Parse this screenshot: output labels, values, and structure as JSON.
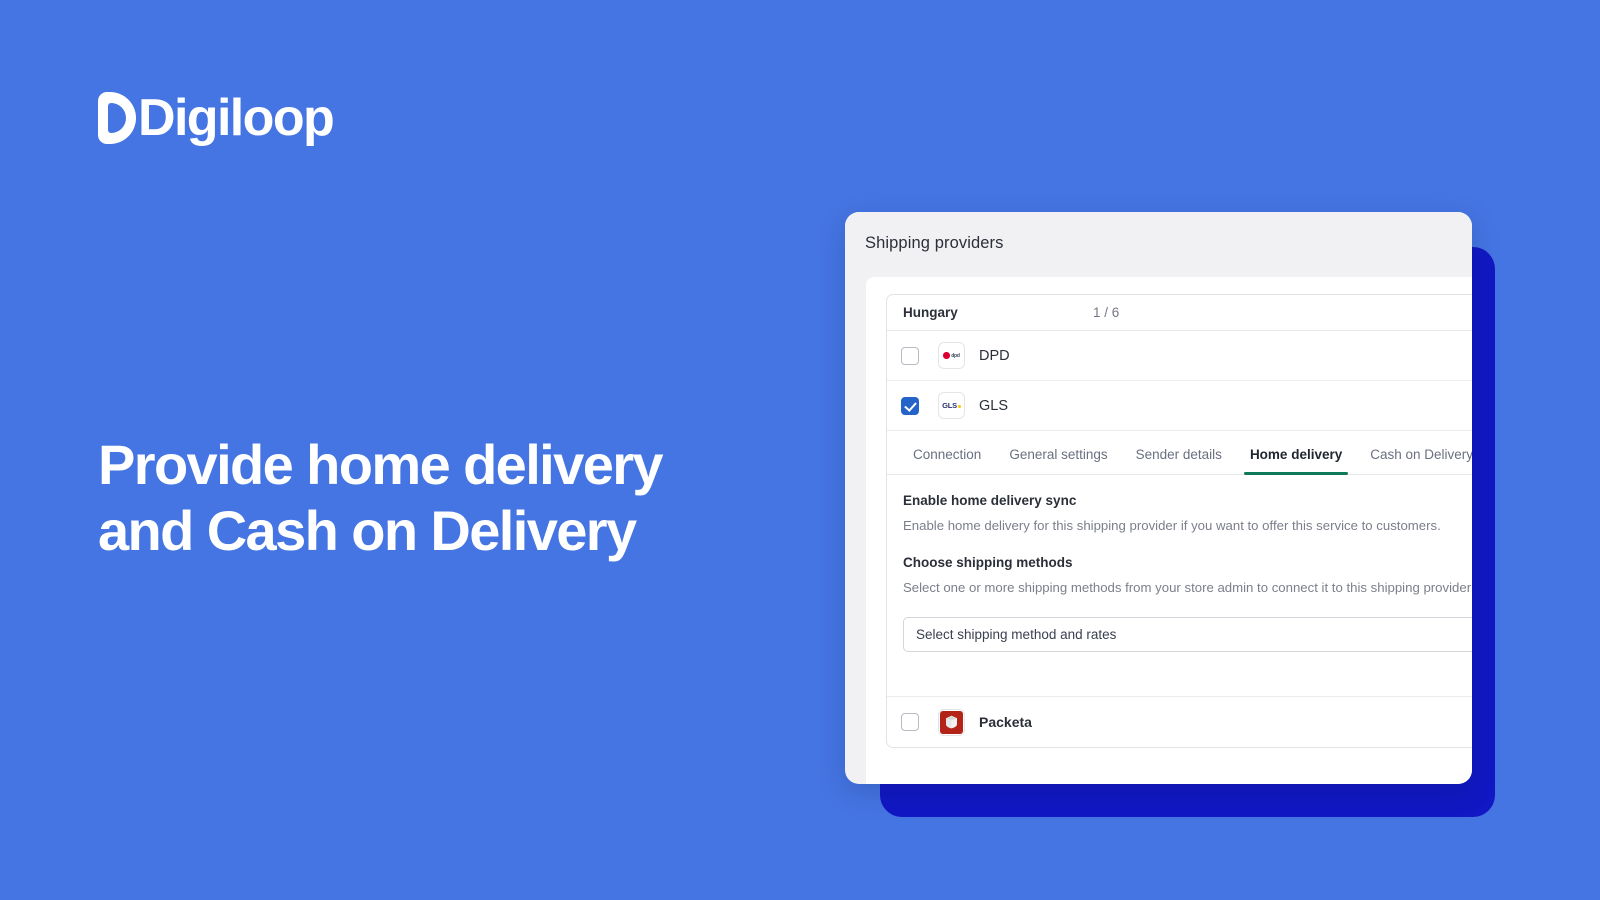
{
  "brand": {
    "name": "Digiloop",
    "mark_icon": "digiloop-d-logo",
    "bg_color": "#4575e3"
  },
  "headline": {
    "line1": "Provide home delivery",
    "line2": "and Cash on Delivery"
  },
  "card": {
    "title": "Shipping providers",
    "shadow_color": "#1118c4",
    "list": {
      "country": "Hungary",
      "count": "1 / 6",
      "providers": [
        {
          "name": "DPD",
          "checked": false,
          "logo_icon": "dpd-logo",
          "logo_text": "dpd"
        },
        {
          "name": "GLS",
          "checked": true,
          "logo_icon": "gls-logo",
          "logo_text": "GLS"
        },
        {
          "name": "Packeta",
          "checked": false,
          "logo_icon": "packeta-logo"
        }
      ]
    },
    "tabs": [
      {
        "label": "Connection",
        "active": false
      },
      {
        "label": "General settings",
        "active": false
      },
      {
        "label": "Sender details",
        "active": false
      },
      {
        "label": "Home delivery",
        "active": true
      },
      {
        "label": "Cash on Delivery",
        "active": false
      }
    ],
    "active_tab_underline_color": "#0f7a5a",
    "home_delivery": {
      "sync_label": "Enable home delivery sync",
      "sync_help": "Enable home delivery for this shipping provider if you want to offer this service to customers.",
      "methods_label": "Choose shipping methods",
      "methods_help": "Select one or more shipping methods from your store admin to connect it to this shipping provider as a",
      "select_value": "Select shipping method and rates"
    }
  }
}
